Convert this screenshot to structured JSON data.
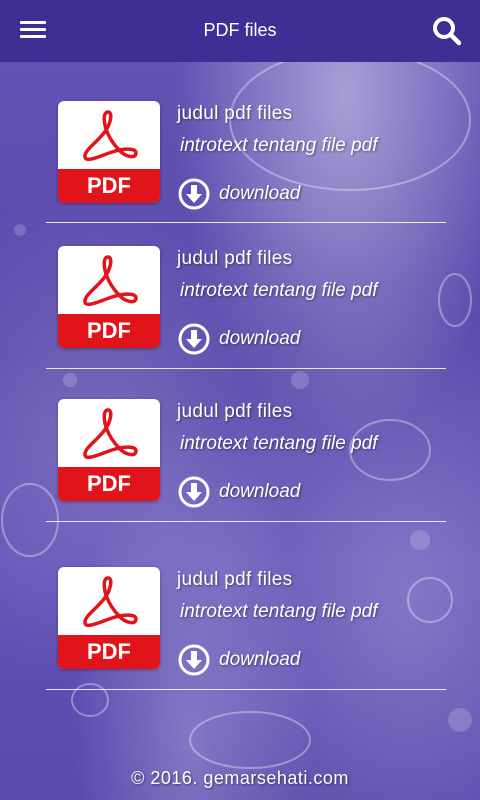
{
  "appbar": {
    "title": "PDF files",
    "menu_icon": "hamburger-menu-icon",
    "search_icon": "search-icon",
    "background_color": "#3d2f93"
  },
  "items": [
    {
      "title": "judul pdf files",
      "intro": "introtext tentang file pdf",
      "download_label": "download",
      "icon_label": "PDF"
    },
    {
      "title": "judul pdf files",
      "intro": "introtext tentang file pdf",
      "download_label": "download",
      "icon_label": "PDF"
    },
    {
      "title": "judul pdf files",
      "intro": "introtext tentang file pdf",
      "download_label": "download",
      "icon_label": "PDF"
    },
    {
      "title": "judul pdf files",
      "intro": "introtext tentang file pdf",
      "download_label": "download",
      "icon_label": "PDF"
    }
  ],
  "footer": {
    "text": "© 2016. gemarsehati.com"
  },
  "colors": {
    "pdf_red": "#e0141a",
    "background_purple": "#5a48ab",
    "text": "#ffffff"
  }
}
